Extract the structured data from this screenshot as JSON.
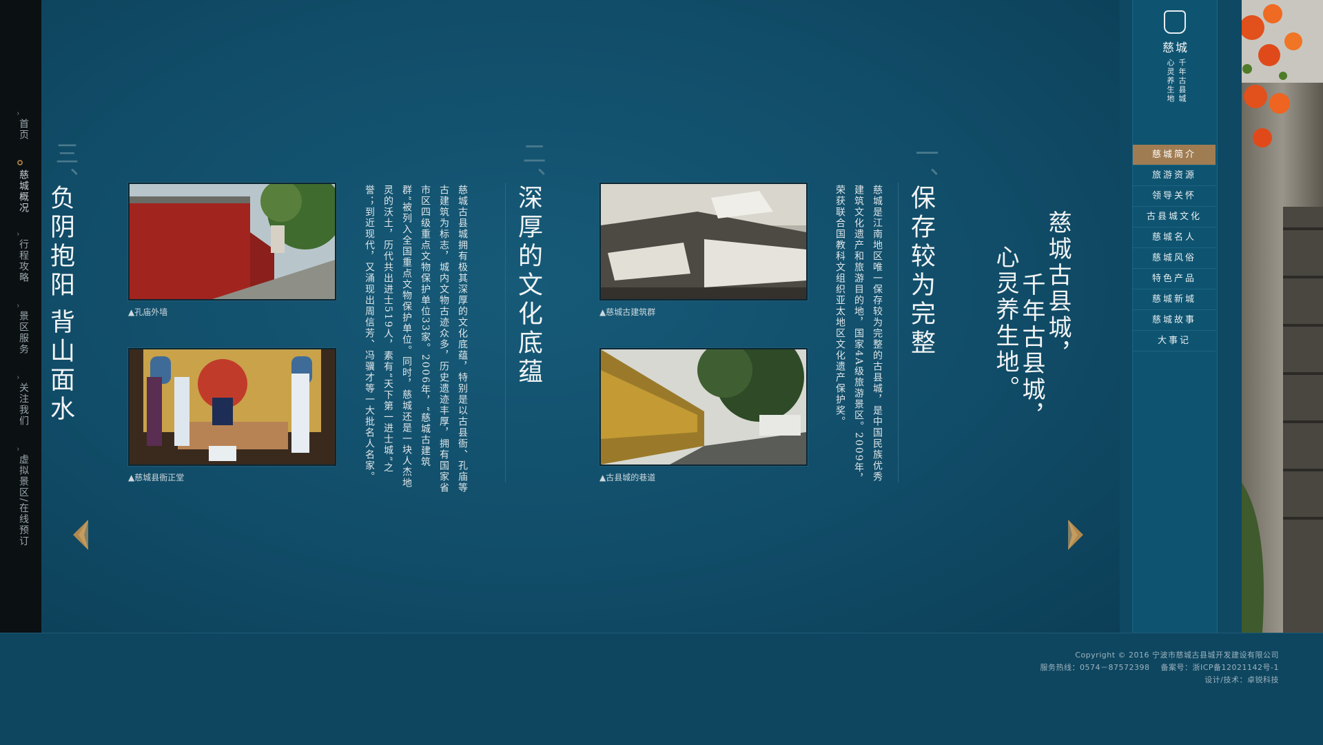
{
  "left_nav": {
    "items": [
      {
        "label": "首页",
        "active": false
      },
      {
        "label": "慈城概况",
        "active": true
      },
      {
        "label": "行程攻略",
        "active": false
      },
      {
        "label": "景区服务",
        "active": false
      },
      {
        "label": "关注我们",
        "active": false
      },
      {
        "label": "虚拟景区/在线预订",
        "active": false
      }
    ]
  },
  "slogan": {
    "line1": "慈城古县城，",
    "line2": "千年古县城，",
    "line3": "心灵养生地。"
  },
  "sections": [
    {
      "number": "一、",
      "heading": "保存较为完整",
      "body": "慈城是江南地区唯一保存较为完整的古县城，是中国民族优秀建筑文化遗产和旅游目的地，国家4A级旅游景区。2009年，荣获联合国教科文组织亚太地区文化遗产保护奖。",
      "photos": [
        {
          "caption": "▲慈城古建筑群"
        },
        {
          "caption": "▲古县城的巷道"
        }
      ]
    },
    {
      "number": "二、",
      "heading": "深厚的文化底蕴",
      "body": "慈城古县城拥有极其深厚的文化底蕴，特别是以古县衙、孔庙等古建筑为标志，城内文物古迹众多，历史遗迹丰厚，拥有国家省市区四级重点文物保护单位33家。2006年，“慈城古建筑群”被列入全国重点文物保护单位。同时，慈城还是一块人杰地灵的沃土，历代共出进士519人，素有“天下第一进士城”之誉；到近现代，又涌现出周信芳、冯骥才等一大批名人名家。",
      "photos": [
        {
          "caption": "▲孔庙外墙"
        },
        {
          "caption": "▲慈城县衙正堂"
        }
      ]
    },
    {
      "number": "三、",
      "heading_line1": "负阴抱阳",
      "heading_line2": "背山面水"
    }
  ],
  "right_panel": {
    "logo_name": "慈城",
    "logo_slogan_1": "千年古县城",
    "logo_slogan_2": "心灵养生地",
    "menu": [
      {
        "label": "慈城简介",
        "active": true
      },
      {
        "label": "旅游资源",
        "active": false
      },
      {
        "label": "领导关怀",
        "active": false
      },
      {
        "label": "古县城文化",
        "active": false
      },
      {
        "label": "慈城名人",
        "active": false
      },
      {
        "label": "慈城风俗",
        "active": false
      },
      {
        "label": "特色产品",
        "active": false
      },
      {
        "label": "慈城新城",
        "active": false
      },
      {
        "label": "慈城故事",
        "active": false
      },
      {
        "label": "大事记",
        "active": false
      }
    ]
  },
  "footer": {
    "copyright": "Copyright © 2016 宁波市慈城古县城开发建设有限公司",
    "contact": "服务热线：0574－87572398    备案号：浙ICP备12021142号-1",
    "credit": "设计/技术：卓锐科技"
  },
  "colors": {
    "bg": "#0f4863",
    "accent": "#a07c52",
    "left_nav": "#0b1013"
  }
}
